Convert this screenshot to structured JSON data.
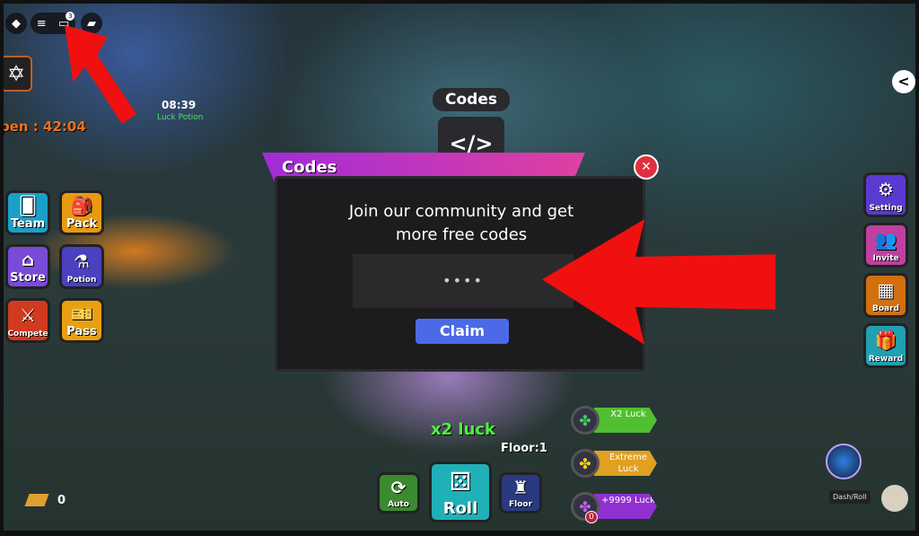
{
  "topbar": {
    "notification_count": "3"
  },
  "timer": {
    "open_label": "pen : 42:04",
    "potion_time": "08:39",
    "potion_name": "Luck Potion"
  },
  "left_menu": [
    {
      "label": "Team",
      "icon": "cards-icon",
      "color": "#1aa0c8"
    },
    {
      "label": "Pack",
      "icon": "backpack-icon",
      "color": "#e89a10"
    },
    {
      "label": "Store",
      "icon": "store-icon",
      "color": "#7a4ad8"
    },
    {
      "label": "Potion",
      "icon": "potion-icon",
      "color": "#4a40c0"
    },
    {
      "label": "Compete",
      "icon": "swords-icon",
      "color": "#d03a20"
    },
    {
      "label": "Pass",
      "icon": "ticket-icon",
      "color": "#e8a010"
    }
  ],
  "right_menu": [
    {
      "label": "Setting",
      "icon": "gear-icon",
      "color": "#5a3ad0"
    },
    {
      "label": "Invite",
      "icon": "people-icon",
      "color": "#c040a0"
    },
    {
      "label": "Board",
      "icon": "grid-icon",
      "color": "#d07010"
    },
    {
      "label": "Reward",
      "icon": "gift-icon",
      "color": "#20a0b0"
    }
  ],
  "codes_sign": {
    "title": "Codes",
    "glyph": "</>"
  },
  "dialog": {
    "title": "Codes",
    "message": "Join our community and get more free codes",
    "input_value": "••••",
    "claim_label": "Claim",
    "close": "✕"
  },
  "bottom": {
    "luck_label": "x2 luck",
    "floor_label": "Floor:1",
    "auto_label": "Auto",
    "roll_label": "Roll",
    "floor_button": "Floor",
    "currency_value": "0"
  },
  "buffs": [
    {
      "label": "X2 Luck",
      "color": "#50c030"
    },
    {
      "label": "Extreme Luck",
      "color": "#e0a020"
    },
    {
      "label": "+9999 Luck",
      "color": "#9030d0"
    }
  ],
  "buff_badge": "0",
  "dash": {
    "label": "Dash/Roll"
  }
}
